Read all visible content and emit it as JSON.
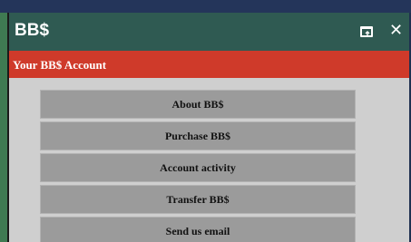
{
  "window": {
    "title": "BB$",
    "popout_icon": "popout-icon",
    "close_icon": "close-icon",
    "close_glyph": "✕"
  },
  "section": {
    "title": "Your BB$ Account"
  },
  "menu": {
    "items": [
      {
        "label": "About BB$"
      },
      {
        "label": "Purchase BB$"
      },
      {
        "label": "Account activity"
      },
      {
        "label": "Transfer BB$"
      },
      {
        "label": "Send us email"
      }
    ]
  },
  "colors": {
    "titlebar": "#2f5a52",
    "section_header": "#cf3a2a",
    "panel": "#cfcfcf",
    "menu_item": "#9b9b9b"
  }
}
